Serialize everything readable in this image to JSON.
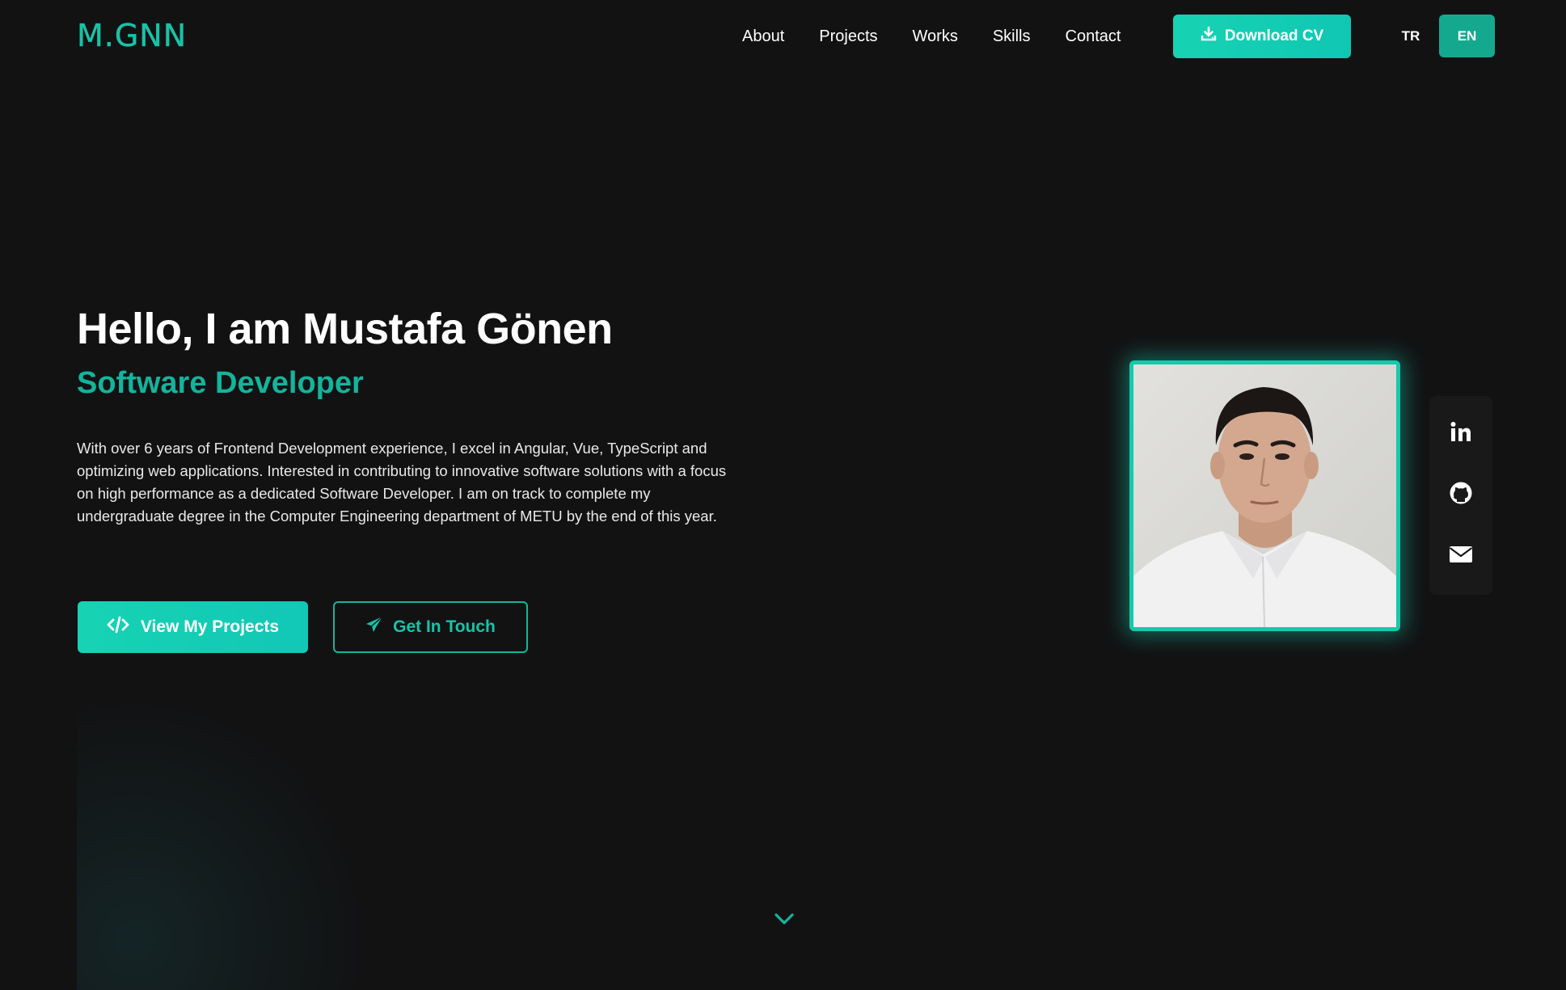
{
  "header": {
    "logo": "M.GNN",
    "nav": [
      "About",
      "Projects",
      "Works",
      "Skills",
      "Contact"
    ],
    "download_cv": "Download CV",
    "lang_tr": "TR",
    "lang_en": "EN",
    "active_language": "EN"
  },
  "hero": {
    "title": "Hello, I am Mustafa Gönen",
    "subtitle": "Software Developer",
    "description": "With over 6 years of Frontend Development experience, I excel in Angular, Vue, TypeScript and optimizing web applications. Interested in contributing to innovative software solutions with a focus on high performance as a dedicated Software Developer. I am on track to complete my undergraduate degree in the Computer Engineering department of METU by the end of this year.",
    "view_projects": "View My Projects",
    "get_in_touch": "Get In Touch"
  },
  "social": {
    "icons": [
      "linkedin-icon",
      "github-icon",
      "mail-icon"
    ]
  },
  "colors": {
    "accent": "#17d3b3",
    "accent_dark": "#14a98f",
    "background": "#121213"
  }
}
